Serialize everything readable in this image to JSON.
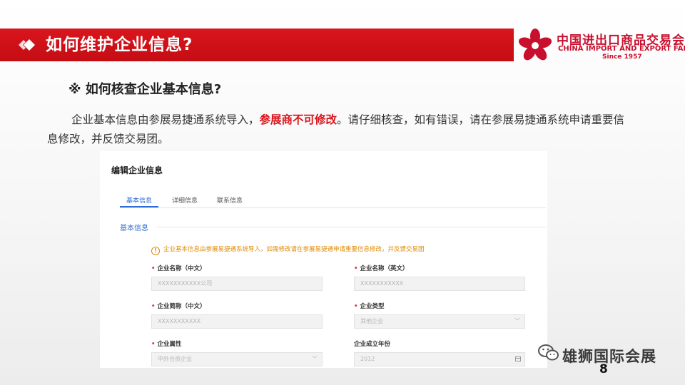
{
  "header": {
    "title": "如何维护企业信息?",
    "brand_color": "#d9151c"
  },
  "logo": {
    "cn_text": "中国进出口商品交易会",
    "en_text": "CHINA IMPORT AND EXPORT FAIR",
    "since": "Since 1957"
  },
  "section": {
    "heading": "※ 如何核查企业基本信息?",
    "para_part1": "企业基本信息由参展易捷通系统导入，",
    "para_highlight": "参展商不可修改",
    "para_part2": "。请仔细核查，如有错误，请在参展易捷通系统申请重要信息修改，并反馈交易团。"
  },
  "panel": {
    "title": "编辑企业信息",
    "tabs": [
      {
        "label": "基本信息",
        "active": true
      },
      {
        "label": "详细信息",
        "active": false
      },
      {
        "label": "联系信息",
        "active": false
      }
    ],
    "subsection_title": "基本信息",
    "notice": "企业基本信息由参展易捷通系统导入，如需修改请在参展易捷通申请重要信息修改，并反馈交易团",
    "fields": [
      {
        "label": "企业名称（中文）",
        "required": true,
        "value": "XXXXXXXXXXX公司"
      },
      {
        "label": "企业名称（英文）",
        "required": true,
        "value": "XXXXXXXXXXX"
      },
      {
        "label": "企业简称（中文）",
        "required": true,
        "value": "XXXXXXXXXXX"
      },
      {
        "label": "企业类型",
        "required": true,
        "value": "其他企业"
      },
      {
        "label": "企业属性",
        "required": true,
        "value": "中外合资企业"
      },
      {
        "label": "企业成立年份",
        "required": false,
        "value": "2012"
      }
    ]
  },
  "watermark": {
    "text": "雄狮国际会展",
    "icon": "wechat-icon"
  },
  "page_number": "8"
}
